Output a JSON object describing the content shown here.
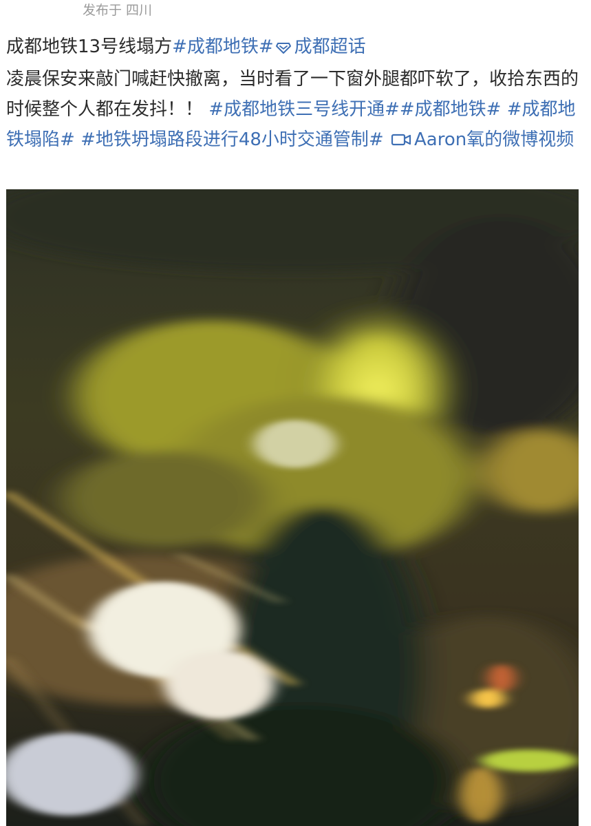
{
  "location": {
    "text": "发布于 四川"
  },
  "post": {
    "text_intro": "成都地铁13号线塌方",
    "topic_metro": "#成都地铁#",
    "topic_super": "成都超话",
    "body": "凌晨保安来敲门喊赶快撤离，当时看了一下窗外腿都吓软了，收拾东西的时候整个人都在发抖！！",
    "topic_line3": "#成都地铁三号线开通#",
    "topic_metro2": "#成都地铁#",
    "topic_collapse": "#成都地铁塌陷#",
    "topic_traffic": "#地铁坍塌路段进行48小时交通管制#",
    "video_link": "Aaron氧的微博视频"
  },
  "icons": {
    "super_topic": "diamond-icon",
    "video": "video-camera-icon"
  },
  "colors": {
    "link": "#3e6fb4",
    "text": "#2b2b2b",
    "meta": "#9a9a9a"
  }
}
